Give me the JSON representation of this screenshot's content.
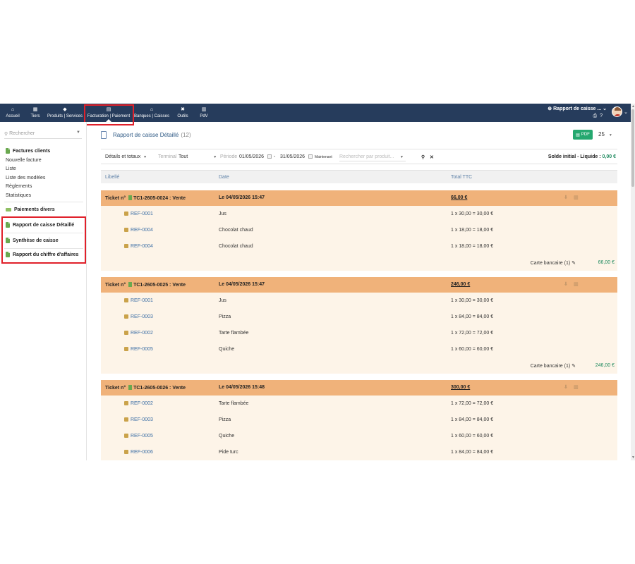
{
  "topnav": {
    "items": [
      {
        "label": "Accueil",
        "icon": "home-icon",
        "glyph": "⌂"
      },
      {
        "label": "Tiers",
        "icon": "building-icon",
        "glyph": "▦"
      },
      {
        "label": "Produits | Services",
        "icon": "cube-icon",
        "glyph": "◆"
      },
      {
        "label": "Facturation | Paiement",
        "icon": "invoice-icon",
        "glyph": "▤"
      },
      {
        "label": "Banques | Caisses",
        "icon": "bank-icon",
        "glyph": "⌂"
      },
      {
        "label": "Outils",
        "icon": "tools-icon",
        "glyph": "✖"
      },
      {
        "label": "PdV",
        "icon": "pos-icon",
        "glyph": "▥"
      }
    ],
    "active": "Facturation | Paiement",
    "right_label": "Rapport de caisse ...",
    "print_glyph": "⎙",
    "help_glyph": "?"
  },
  "sidebar": {
    "search_placeholder": "Rechercher",
    "sections": [
      {
        "title": "Factures clients",
        "links": [
          "Nouvelle facture",
          "Liste",
          "Liste des modèles",
          "Règlements",
          "Statistiques"
        ]
      },
      {
        "title": "Paiements divers",
        "links": []
      },
      {
        "title": "Rapport de caisse Détaillé",
        "links": []
      },
      {
        "title": "Synthèse de caisse",
        "links": []
      },
      {
        "title": "Rapport du chiffre d'affaires",
        "links": []
      }
    ]
  },
  "page": {
    "title": "Rapport de caisse Détaillé",
    "count": "(12)",
    "pdf_label": "PDF",
    "per_page": "25"
  },
  "filters": {
    "mode": "Détails et totaux",
    "terminal_label": "Terminal",
    "terminal_value": "Tout",
    "period_label": "Période",
    "date_from": "01/05/2026",
    "date_sep": "-",
    "date_to": "31/05/2026",
    "now_label": "Maintenant",
    "product_search_placeholder": "Rechercher par produit...",
    "search_glyph": "⚲",
    "clear_glyph": "✕",
    "solde_label": "Solde initial - Liquide :",
    "solde_value": "0,00 €"
  },
  "table": {
    "columns": [
      "Libellé",
      "Date",
      "Total TTC"
    ]
  },
  "tickets": [
    {
      "ticket": "Ticket n° ",
      "ref": "TC1-2605-0024 : Vente",
      "date": "Le 04/05/2026 15:47",
      "total": "66,00 €",
      "lines": [
        {
          "ref": "REF-0001",
          "name": "Jus",
          "qty": "1 x 30,00 = 30,00 €"
        },
        {
          "ref": "REF-0004",
          "name": "Chocolat chaud",
          "qty": "1 x 18,00 = 18,00 €"
        },
        {
          "ref": "REF-0004",
          "name": "Chocolat chaud",
          "qty": "1 x 18,00 = 18,00 €"
        }
      ],
      "payment": {
        "method": "Carte bancaire (1)",
        "amount": "66,00 €"
      }
    },
    {
      "ticket": "Ticket n° ",
      "ref": "TC1-2605-0025 : Vente",
      "date": "Le 04/05/2026 15:47",
      "total": "246,00 €",
      "lines": [
        {
          "ref": "REF-0001",
          "name": "Jus",
          "qty": "1 x 30,00 = 30,00 €"
        },
        {
          "ref": "REF-0003",
          "name": "Pizza",
          "qty": "1 x 84,00 = 84,00 €"
        },
        {
          "ref": "REF-0002",
          "name": "Tarte flambée",
          "qty": "1 x 72,00 = 72,00 €"
        },
        {
          "ref": "REF-0005",
          "name": "Quiche",
          "qty": "1 x 60,00 = 60,00 €"
        }
      ],
      "payment": {
        "method": "Carte bancaire (1)",
        "amount": "246,00 €"
      }
    },
    {
      "ticket": "Ticket n° ",
      "ref": "TC1-2605-0026 : Vente",
      "date": "Le 04/05/2026 15:48",
      "total": "300,00 €",
      "lines": [
        {
          "ref": "REF-0002",
          "name": "Tarte flambée",
          "qty": "1 x 72,00 = 72,00 €"
        },
        {
          "ref": "REF-0003",
          "name": "Pizza",
          "qty": "1 x 84,00 = 84,00 €"
        },
        {
          "ref": "REF-0005",
          "name": "Quiche",
          "qty": "1 x 60,00 = 60,00 €"
        },
        {
          "ref": "REF-0006",
          "name": "Pide turc",
          "qty": "1 x 84,00 = 84,00 €"
        }
      ],
      "payment": null
    }
  ],
  "colors": {
    "topbar": "#263c5c",
    "ticket_header": "#f0b27a",
    "ticket_body": "#fdf4e8",
    "accent_green": "#1f8a5f",
    "highlight_red": "#e0202a"
  }
}
